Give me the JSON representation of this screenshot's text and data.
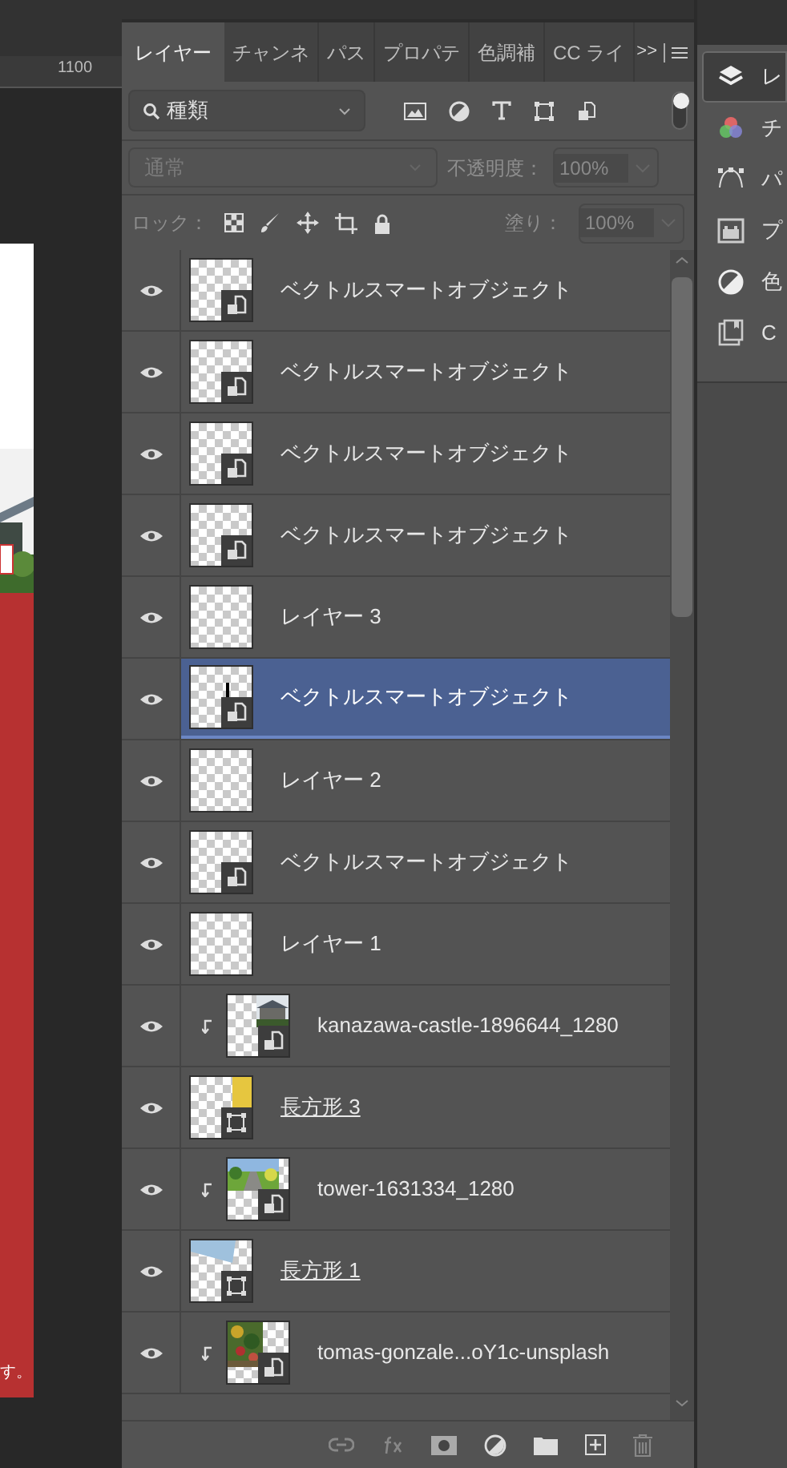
{
  "ruler": {
    "label": "1100"
  },
  "document": {
    "caption": "す。"
  },
  "tabs": [
    {
      "label": "レイヤー",
      "selected": true
    },
    {
      "label": "チャンネ",
      "selected": false
    },
    {
      "label": "パス",
      "selected": false
    },
    {
      "label": "プロパテ",
      "selected": false
    },
    {
      "label": "色調補",
      "selected": false
    },
    {
      "label": "CC ライ",
      "selected": false
    }
  ],
  "tab_overflow": ">>",
  "filter": {
    "value": "種類",
    "on": true
  },
  "blend": {
    "value": "通常",
    "disabled": true
  },
  "opacity": {
    "label": "不透明度：",
    "value": "100%",
    "disabled": true
  },
  "lock": {
    "label": "ロック："
  },
  "fill": {
    "label": "塗り：",
    "value": "100%",
    "disabled": true
  },
  "layers": [
    {
      "name": "ベクトルスマートオブジェクト",
      "kind": "smart",
      "thumbnail": {
        "kind": "blank"
      },
      "clipped": false,
      "underlined": false,
      "visible": true,
      "selected": false
    },
    {
      "name": "ベクトルスマートオブジェクト",
      "kind": "smart",
      "thumbnail": {
        "kind": "blank"
      },
      "clipped": false,
      "underlined": false,
      "visible": true,
      "selected": false
    },
    {
      "name": "ベクトルスマートオブジェクト",
      "kind": "smart",
      "thumbnail": {
        "kind": "blank"
      },
      "clipped": false,
      "underlined": false,
      "visible": true,
      "selected": false
    },
    {
      "name": "ベクトルスマートオブジェクト",
      "kind": "smart",
      "thumbnail": {
        "kind": "blank"
      },
      "clipped": false,
      "underlined": false,
      "visible": true,
      "selected": false
    },
    {
      "name": "レイヤー 3",
      "kind": "pixel",
      "thumbnail": {
        "kind": "blank"
      },
      "clipped": false,
      "underlined": false,
      "visible": true,
      "selected": false
    },
    {
      "name": "ベクトルスマートオブジェクト",
      "kind": "smart",
      "thumbnail": {
        "kind": "mark"
      },
      "clipped": false,
      "underlined": false,
      "visible": true,
      "selected": true
    },
    {
      "name": "レイヤー 2",
      "kind": "pixel",
      "thumbnail": {
        "kind": "blank"
      },
      "clipped": false,
      "underlined": false,
      "visible": true,
      "selected": false
    },
    {
      "name": "ベクトルスマートオブジェクト",
      "kind": "smart",
      "thumbnail": {
        "kind": "blank"
      },
      "clipped": false,
      "underlined": false,
      "visible": true,
      "selected": false
    },
    {
      "name": "レイヤー 1",
      "kind": "pixel",
      "thumbnail": {
        "kind": "blank"
      },
      "clipped": false,
      "underlined": false,
      "visible": true,
      "selected": false
    },
    {
      "name": "kanazawa-castle-1896644_1280",
      "kind": "smart",
      "clipped": true,
      "underlined": false,
      "visible": true,
      "selected": false
    },
    {
      "name": "長方形 3",
      "kind": "shape",
      "thumbnail": {
        "kind": "yellow"
      },
      "clipped": false,
      "underlined": true,
      "visible": true,
      "selected": false
    },
    {
      "name": "tower-1631334_1280",
      "kind": "smart",
      "clipped": true,
      "underlined": false,
      "visible": true,
      "selected": false
    },
    {
      "name": "長方形 1",
      "kind": "shape",
      "thumbnail": {
        "kind": "sky"
      },
      "clipped": false,
      "underlined": true,
      "visible": true,
      "selected": false
    },
    {
      "name": "tomas-gonzale...oY1c-unsplash",
      "kind": "smart",
      "clipped": true,
      "underlined": false,
      "visible": true,
      "selected": false
    }
  ],
  "dock": [
    {
      "kind": "layers",
      "label": "レ",
      "selected": true
    },
    {
      "kind": "channels",
      "label": "チ",
      "selected": false
    },
    {
      "kind": "paths",
      "label": "パ",
      "selected": false
    },
    {
      "kind": "properties",
      "label": "プ",
      "selected": false
    },
    {
      "kind": "adjustments",
      "label": "色",
      "selected": false
    },
    {
      "kind": "libraries",
      "label": "C",
      "selected": false
    }
  ]
}
